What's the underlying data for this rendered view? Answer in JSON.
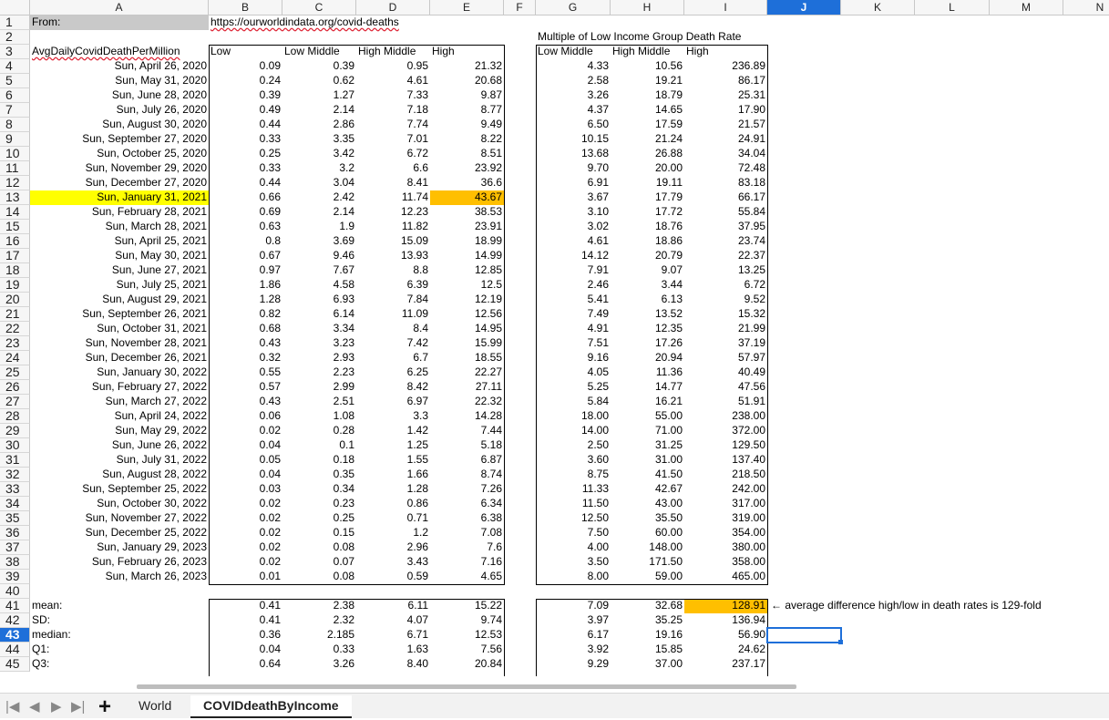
{
  "columns": [
    "A",
    "B",
    "C",
    "D",
    "E",
    "F",
    "G",
    "H",
    "I",
    "J",
    "K",
    "L",
    "M",
    "N"
  ],
  "selected_column": "J",
  "selected_row": "43",
  "rows": [
    {
      "n": "1",
      "a": "From:",
      "b": "https://ourworldindata.org/covid-deaths"
    },
    {
      "n": "2",
      "g": "Multiple of Low Income Group Death Rate"
    },
    {
      "n": "3",
      "a": "AvgDailyCovidDeathPerMillion",
      "b": "Low",
      "c": "Low Middle",
      "d": "High Middle",
      "e": "High",
      "g": "Low Middle",
      "h": "High Middle",
      "i": "High"
    },
    {
      "n": "4",
      "a": "Sun, April 26, 2020",
      "b": "0.09",
      "c": "0.39",
      "d": "0.95",
      "e": "21.32",
      "g": "4.33",
      "h": "10.56",
      "i": "236.89"
    },
    {
      "n": "5",
      "a": "Sun, May 31, 2020",
      "b": "0.24",
      "c": "0.62",
      "d": "4.61",
      "e": "20.68",
      "g": "2.58",
      "h": "19.21",
      "i": "86.17"
    },
    {
      "n": "6",
      "a": "Sun, June 28, 2020",
      "b": "0.39",
      "c": "1.27",
      "d": "7.33",
      "e": "9.87",
      "g": "3.26",
      "h": "18.79",
      "i": "25.31"
    },
    {
      "n": "7",
      "a": "Sun, July 26, 2020",
      "b": "0.49",
      "c": "2.14",
      "d": "7.18",
      "e": "8.77",
      "g": "4.37",
      "h": "14.65",
      "i": "17.90"
    },
    {
      "n": "8",
      "a": "Sun, August 30, 2020",
      "b": "0.44",
      "c": "2.86",
      "d": "7.74",
      "e": "9.49",
      "g": "6.50",
      "h": "17.59",
      "i": "21.57"
    },
    {
      "n": "9",
      "a": "Sun, September 27, 2020",
      "b": "0.33",
      "c": "3.35",
      "d": "7.01",
      "e": "8.22",
      "g": "10.15",
      "h": "21.24",
      "i": "24.91"
    },
    {
      "n": "10",
      "a": "Sun, October 25, 2020",
      "b": "0.25",
      "c": "3.42",
      "d": "6.72",
      "e": "8.51",
      "g": "13.68",
      "h": "26.88",
      "i": "34.04"
    },
    {
      "n": "11",
      "a": "Sun, November 29, 2020",
      "b": "0.33",
      "c": "3.2",
      "d": "6.6",
      "e": "23.92",
      "g": "9.70",
      "h": "20.00",
      "i": "72.48"
    },
    {
      "n": "12",
      "a": "Sun, December 27, 2020",
      "b": "0.44",
      "c": "3.04",
      "d": "8.41",
      "e": "36.6",
      "g": "6.91",
      "h": "19.11",
      "i": "83.18"
    },
    {
      "n": "13",
      "a": "Sun, January 31, 2021",
      "b": "0.66",
      "c": "2.42",
      "d": "11.74",
      "e": "43.67",
      "g": "3.67",
      "h": "17.79",
      "i": "66.17"
    },
    {
      "n": "14",
      "a": "Sun, February 28, 2021",
      "b": "0.69",
      "c": "2.14",
      "d": "12.23",
      "e": "38.53",
      "g": "3.10",
      "h": "17.72",
      "i": "55.84"
    },
    {
      "n": "15",
      "a": "Sun, March 28, 2021",
      "b": "0.63",
      "c": "1.9",
      "d": "11.82",
      "e": "23.91",
      "g": "3.02",
      "h": "18.76",
      "i": "37.95"
    },
    {
      "n": "16",
      "a": "Sun, April 25, 2021",
      "b": "0.8",
      "c": "3.69",
      "d": "15.09",
      "e": "18.99",
      "g": "4.61",
      "h": "18.86",
      "i": "23.74"
    },
    {
      "n": "17",
      "a": "Sun, May 30, 2021",
      "b": "0.67",
      "c": "9.46",
      "d": "13.93",
      "e": "14.99",
      "g": "14.12",
      "h": "20.79",
      "i": "22.37"
    },
    {
      "n": "18",
      "a": "Sun, June 27, 2021",
      "b": "0.97",
      "c": "7.67",
      "d": "8.8",
      "e": "12.85",
      "g": "7.91",
      "h": "9.07",
      "i": "13.25"
    },
    {
      "n": "19",
      "a": "Sun, July 25, 2021",
      "b": "1.86",
      "c": "4.58",
      "d": "6.39",
      "e": "12.5",
      "g": "2.46",
      "h": "3.44",
      "i": "6.72"
    },
    {
      "n": "20",
      "a": "Sun, August 29, 2021",
      "b": "1.28",
      "c": "6.93",
      "d": "7.84",
      "e": "12.19",
      "g": "5.41",
      "h": "6.13",
      "i": "9.52"
    },
    {
      "n": "21",
      "a": "Sun, September 26, 2021",
      "b": "0.82",
      "c": "6.14",
      "d": "11.09",
      "e": "12.56",
      "g": "7.49",
      "h": "13.52",
      "i": "15.32"
    },
    {
      "n": "22",
      "a": "Sun, October 31, 2021",
      "b": "0.68",
      "c": "3.34",
      "d": "8.4",
      "e": "14.95",
      "g": "4.91",
      "h": "12.35",
      "i": "21.99"
    },
    {
      "n": "23",
      "a": "Sun, November 28, 2021",
      "b": "0.43",
      "c": "3.23",
      "d": "7.42",
      "e": "15.99",
      "g": "7.51",
      "h": "17.26",
      "i": "37.19"
    },
    {
      "n": "24",
      "a": "Sun, December 26, 2021",
      "b": "0.32",
      "c": "2.93",
      "d": "6.7",
      "e": "18.55",
      "g": "9.16",
      "h": "20.94",
      "i": "57.97"
    },
    {
      "n": "25",
      "a": "Sun, January 30, 2022",
      "b": "0.55",
      "c": "2.23",
      "d": "6.25",
      "e": "22.27",
      "g": "4.05",
      "h": "11.36",
      "i": "40.49"
    },
    {
      "n": "26",
      "a": "Sun, February 27, 2022",
      "b": "0.57",
      "c": "2.99",
      "d": "8.42",
      "e": "27.11",
      "g": "5.25",
      "h": "14.77",
      "i": "47.56"
    },
    {
      "n": "27",
      "a": "Sun, March 27, 2022",
      "b": "0.43",
      "c": "2.51",
      "d": "6.97",
      "e": "22.32",
      "g": "5.84",
      "h": "16.21",
      "i": "51.91"
    },
    {
      "n": "28",
      "a": "Sun, April 24, 2022",
      "b": "0.06",
      "c": "1.08",
      "d": "3.3",
      "e": "14.28",
      "g": "18.00",
      "h": "55.00",
      "i": "238.00"
    },
    {
      "n": "29",
      "a": "Sun, May 29, 2022",
      "b": "0.02",
      "c": "0.28",
      "d": "1.42",
      "e": "7.44",
      "g": "14.00",
      "h": "71.00",
      "i": "372.00"
    },
    {
      "n": "30",
      "a": "Sun, June 26, 2022",
      "b": "0.04",
      "c": "0.1",
      "d": "1.25",
      "e": "5.18",
      "g": "2.50",
      "h": "31.25",
      "i": "129.50"
    },
    {
      "n": "31",
      "a": "Sun, July 31, 2022",
      "b": "0.05",
      "c": "0.18",
      "d": "1.55",
      "e": "6.87",
      "g": "3.60",
      "h": "31.00",
      "i": "137.40"
    },
    {
      "n": "32",
      "a": "Sun, August 28, 2022",
      "b": "0.04",
      "c": "0.35",
      "d": "1.66",
      "e": "8.74",
      "g": "8.75",
      "h": "41.50",
      "i": "218.50"
    },
    {
      "n": "33",
      "a": "Sun, September 25, 2022",
      "b": "0.03",
      "c": "0.34",
      "d": "1.28",
      "e": "7.26",
      "g": "11.33",
      "h": "42.67",
      "i": "242.00"
    },
    {
      "n": "34",
      "a": "Sun, October 30, 2022",
      "b": "0.02",
      "c": "0.23",
      "d": "0.86",
      "e": "6.34",
      "g": "11.50",
      "h": "43.00",
      "i": "317.00"
    },
    {
      "n": "35",
      "a": "Sun, November 27, 2022",
      "b": "0.02",
      "c": "0.25",
      "d": "0.71",
      "e": "6.38",
      "g": "12.50",
      "h": "35.50",
      "i": "319.00"
    },
    {
      "n": "36",
      "a": "Sun, December 25, 2022",
      "b": "0.02",
      "c": "0.15",
      "d": "1.2",
      "e": "7.08",
      "g": "7.50",
      "h": "60.00",
      "i": "354.00"
    },
    {
      "n": "37",
      "a": "Sun, January 29, 2023",
      "b": "0.02",
      "c": "0.08",
      "d": "2.96",
      "e": "7.6",
      "g": "4.00",
      "h": "148.00",
      "i": "380.00"
    },
    {
      "n": "38",
      "a": "Sun, February 26, 2023",
      "b": "0.02",
      "c": "0.07",
      "d": "3.43",
      "e": "7.16",
      "g": "3.50",
      "h": "171.50",
      "i": "358.00"
    },
    {
      "n": "39",
      "a": "Sun, March 26, 2023",
      "b": "0.01",
      "c": "0.08",
      "d": "0.59",
      "e": "4.65",
      "g": "8.00",
      "h": "59.00",
      "i": "465.00"
    },
    {
      "n": "40"
    },
    {
      "n": "41",
      "a": "mean:",
      "b": "0.41",
      "c": "2.38",
      "d": "6.11",
      "e": "15.22",
      "g": "7.09",
      "h": "32.68",
      "i": "128.91",
      "j": "← average difference high/low in death rates is 129-fold"
    },
    {
      "n": "42",
      "a": "SD:",
      "b": "0.41",
      "c": "2.32",
      "d": "4.07",
      "e": "9.74",
      "g": "3.97",
      "h": "35.25",
      "i": "136.94"
    },
    {
      "n": "43",
      "a": "median:",
      "b": "0.36",
      "c": "2.185",
      "d": "6.71",
      "e": "12.53",
      "g": "6.17",
      "h": "19.16",
      "i": "56.90"
    },
    {
      "n": "44",
      "a": "Q1:",
      "b": "0.04",
      "c": "0.33",
      "d": "1.63",
      "e": "7.56",
      "g": "3.92",
      "h": "15.85",
      "i": "24.62"
    },
    {
      "n": "45",
      "a": "Q3:",
      "b": "0.64",
      "c": "3.26",
      "d": "8.40",
      "e": "20.84",
      "g": "9.29",
      "h": "37.00",
      "i": "237.17"
    }
  ],
  "highlights": {
    "yellow_cell": "A13",
    "orange_cells": [
      "E13",
      "I41"
    ],
    "yellow": "#ffff00",
    "orange": "#ffbf00"
  },
  "selected_cell": "J43",
  "tabs": [
    {
      "label": "World",
      "active": false
    },
    {
      "label": "COVIDdeathByIncome",
      "active": true
    }
  ],
  "icons": {
    "first": "first-sheet-icon",
    "prev": "prev-sheet-icon",
    "next": "next-sheet-icon",
    "last": "last-sheet-icon",
    "add": "add-sheet-icon"
  },
  "nav_glyphs": {
    "first": "|◀",
    "prev": "◀",
    "next": "▶",
    "last": "▶|",
    "add": "+"
  }
}
